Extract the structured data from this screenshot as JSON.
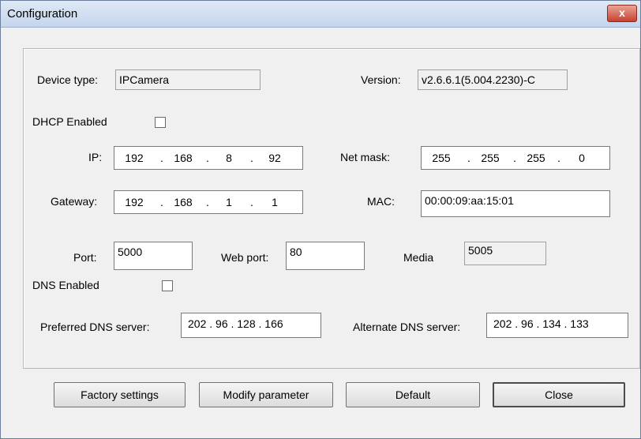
{
  "window": {
    "title": "Configuration",
    "close_glyph": "x"
  },
  "labels": {
    "device_type": "Device type:",
    "version": "Version:",
    "dhcp": "DHCP Enabled",
    "ip": "IP:",
    "netmask": "Net mask:",
    "gateway": "Gateway:",
    "mac": "MAC:",
    "port": "Port:",
    "web_port": "Web port:",
    "media": "Media",
    "dns": "DNS Enabled",
    "preferred_dns": "Preferred DNS server:",
    "alternate_dns": "Alternate DNS server:"
  },
  "values": {
    "device_type": "IPCamera",
    "version": "v2.6.6.1(5.004.2230)-C",
    "dhcp_enabled": false,
    "ip": [
      "192",
      "168",
      "8",
      "92"
    ],
    "netmask": [
      "255",
      "255",
      "255",
      "0"
    ],
    "gateway": [
      "192",
      "168",
      "1",
      "1"
    ],
    "mac": "00:00:09:aa:15:01",
    "port": "5000",
    "web_port": "80",
    "media": "5005",
    "dns_enabled": false,
    "preferred_dns": "202 . 96 . 128 . 166",
    "alternate_dns": "202 . 96 . 134 . 133"
  },
  "buttons": {
    "factory": "Factory settings",
    "modify": "Modify parameter",
    "default": "Default",
    "close": "Close"
  }
}
